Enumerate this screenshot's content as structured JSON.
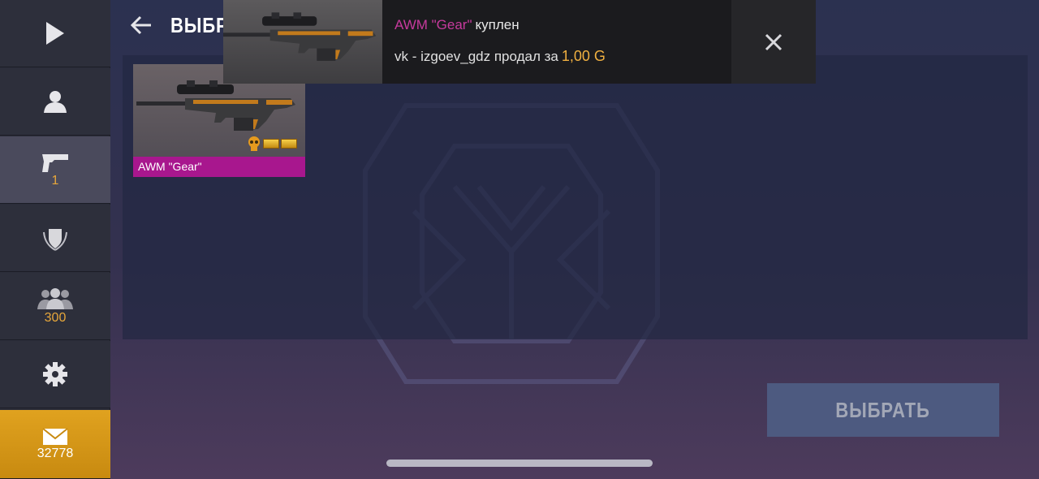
{
  "header": {
    "title": "ВЫБРА"
  },
  "sidebar": {
    "items": [
      {
        "name": "play",
        "icon": "play-icon",
        "count": ""
      },
      {
        "name": "profile",
        "icon": "user-icon",
        "count": ""
      },
      {
        "name": "inventory",
        "icon": "pistol-icon",
        "count": "1"
      },
      {
        "name": "clan",
        "icon": "shield-icon",
        "count": ""
      },
      {
        "name": "friends",
        "icon": "group-icon",
        "count": "300"
      },
      {
        "name": "settings",
        "icon": "gear-icon",
        "count": ""
      },
      {
        "name": "mail",
        "icon": "envelope-icon",
        "count": "32778"
      }
    ]
  },
  "items": [
    {
      "name": "AWM \"Gear\"",
      "rarity_color": "#a8178e"
    }
  ],
  "notification": {
    "item": "AWM \"Gear\"",
    "verb": "куплен",
    "line": "vk - izgoev_gdz продал за",
    "price": "1,00 G"
  },
  "actions": {
    "select": "ВЫБРАТЬ"
  },
  "colors": {
    "accent": "#e0a21f",
    "rarity": "#a8178e",
    "price": "#f0b041",
    "item_text": "#c73a9d"
  }
}
